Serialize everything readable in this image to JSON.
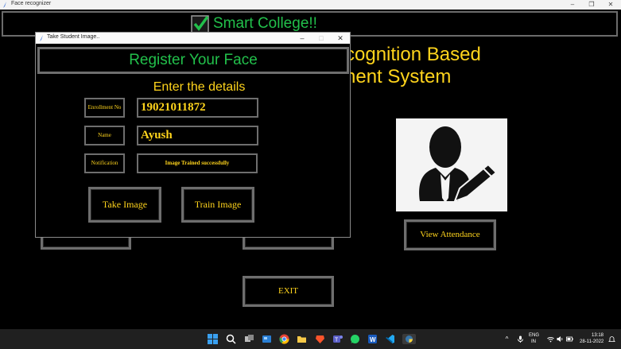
{
  "main_window": {
    "title": "Face recognizer",
    "brand_title": "Smart College!!",
    "heading_line1": "cognition Based",
    "heading_line2": "nent System",
    "view_attendance_label": "View Attendance",
    "exit_label": "EXIT"
  },
  "dialog": {
    "title": "Take Student Image..",
    "register_title": "Register Your Face",
    "enter_details": "Enter the details",
    "enrollment_label": "Enrollment No",
    "enrollment_value": "19021011872",
    "name_label": "Name",
    "name_value": "Ayush",
    "notification_label": "Notification",
    "notification_value": "Image Trained successfully",
    "take_image_label": "Take Image",
    "train_image_label": "Train Image"
  },
  "taskbar": {
    "lang_line1": "ENG",
    "lang_line2": "IN",
    "time": "13:18",
    "date": "28-11-2022",
    "apps": [
      "start-icon",
      "search-icon",
      "task-view-icon",
      "widgets-icon",
      "chrome-icon",
      "file-explorer-icon",
      "brave-icon",
      "teams-icon",
      "whatsapp-icon",
      "word-icon",
      "vscode-icon",
      "python-icon"
    ]
  },
  "colors": {
    "accent_yellow": "#ffd41c",
    "accent_green": "#22c04b",
    "border_gray": "#6e6e6e"
  }
}
